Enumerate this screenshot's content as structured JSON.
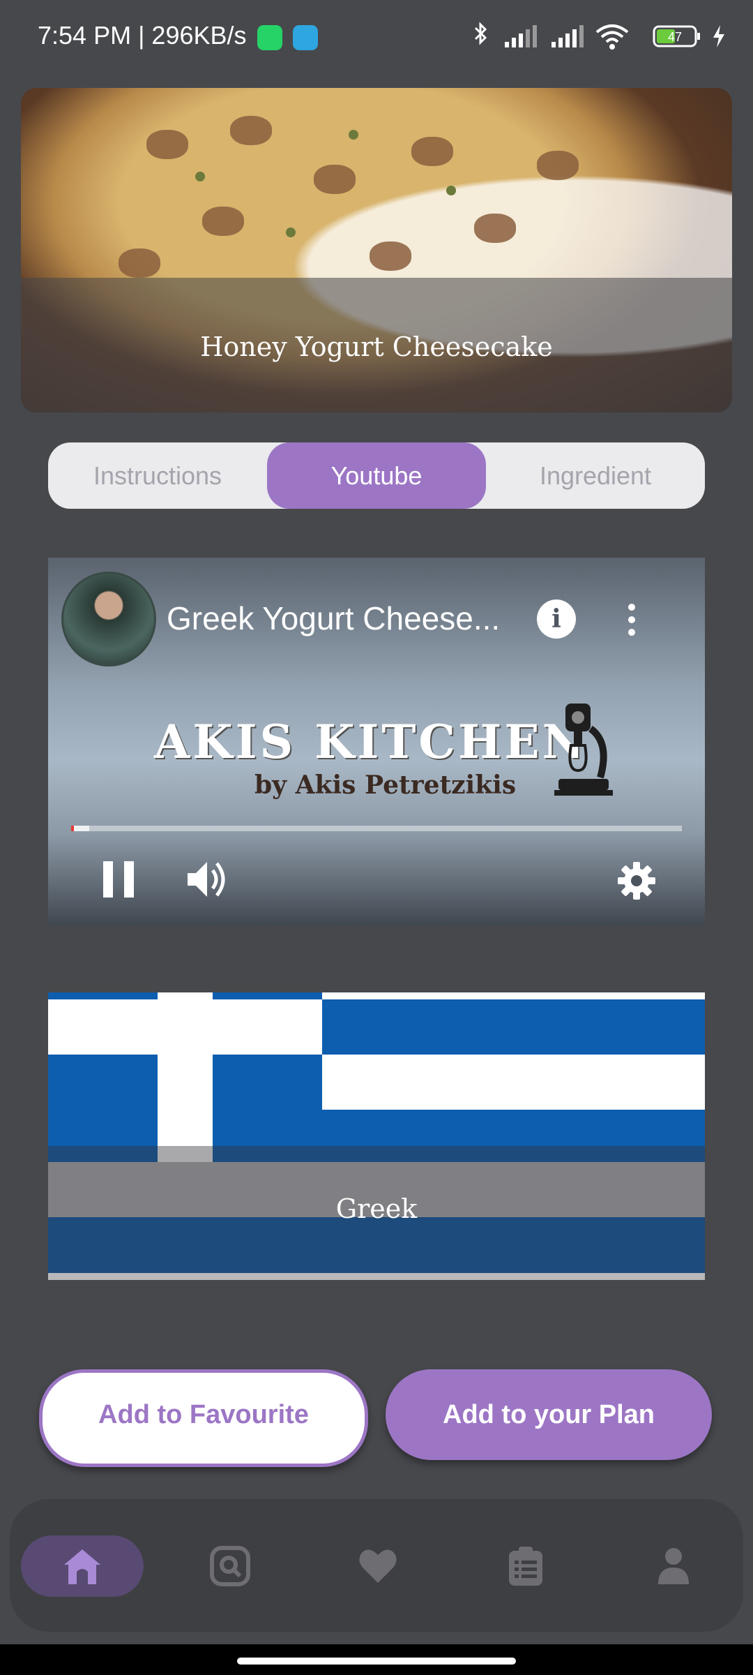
{
  "status_bar": {
    "time_speed": "7:54 PM | 296KB/s",
    "battery": "47"
  },
  "hero": {
    "title": "Honey Yogurt Cheesecake"
  },
  "tabs": [
    {
      "label": "Instructions",
      "selected": false
    },
    {
      "label": "Youtube",
      "selected": true
    },
    {
      "label": "Ingredient",
      "selected": false
    }
  ],
  "video": {
    "title": "Greek Yogurt Cheese...",
    "brand": "AKIS KITCHEN",
    "byline": "by Akis Petretzikis",
    "progress": 0.005,
    "buffered": 0.03
  },
  "cuisine": {
    "label": "Greek"
  },
  "actions": {
    "favourite_label": "Add to Favourite",
    "plan_label": "Add to your Plan"
  },
  "bottom_nav": {
    "items": [
      {
        "icon": "home-icon",
        "selected": true
      },
      {
        "icon": "search-icon",
        "selected": false
      },
      {
        "icon": "heart-icon",
        "selected": false
      },
      {
        "icon": "clipboard-list-icon",
        "selected": false
      },
      {
        "icon": "person-icon",
        "selected": false
      }
    ]
  },
  "colors": {
    "accent": "#9c76c5",
    "background": "#47484c",
    "flag_blue": "#0d5eaf"
  }
}
